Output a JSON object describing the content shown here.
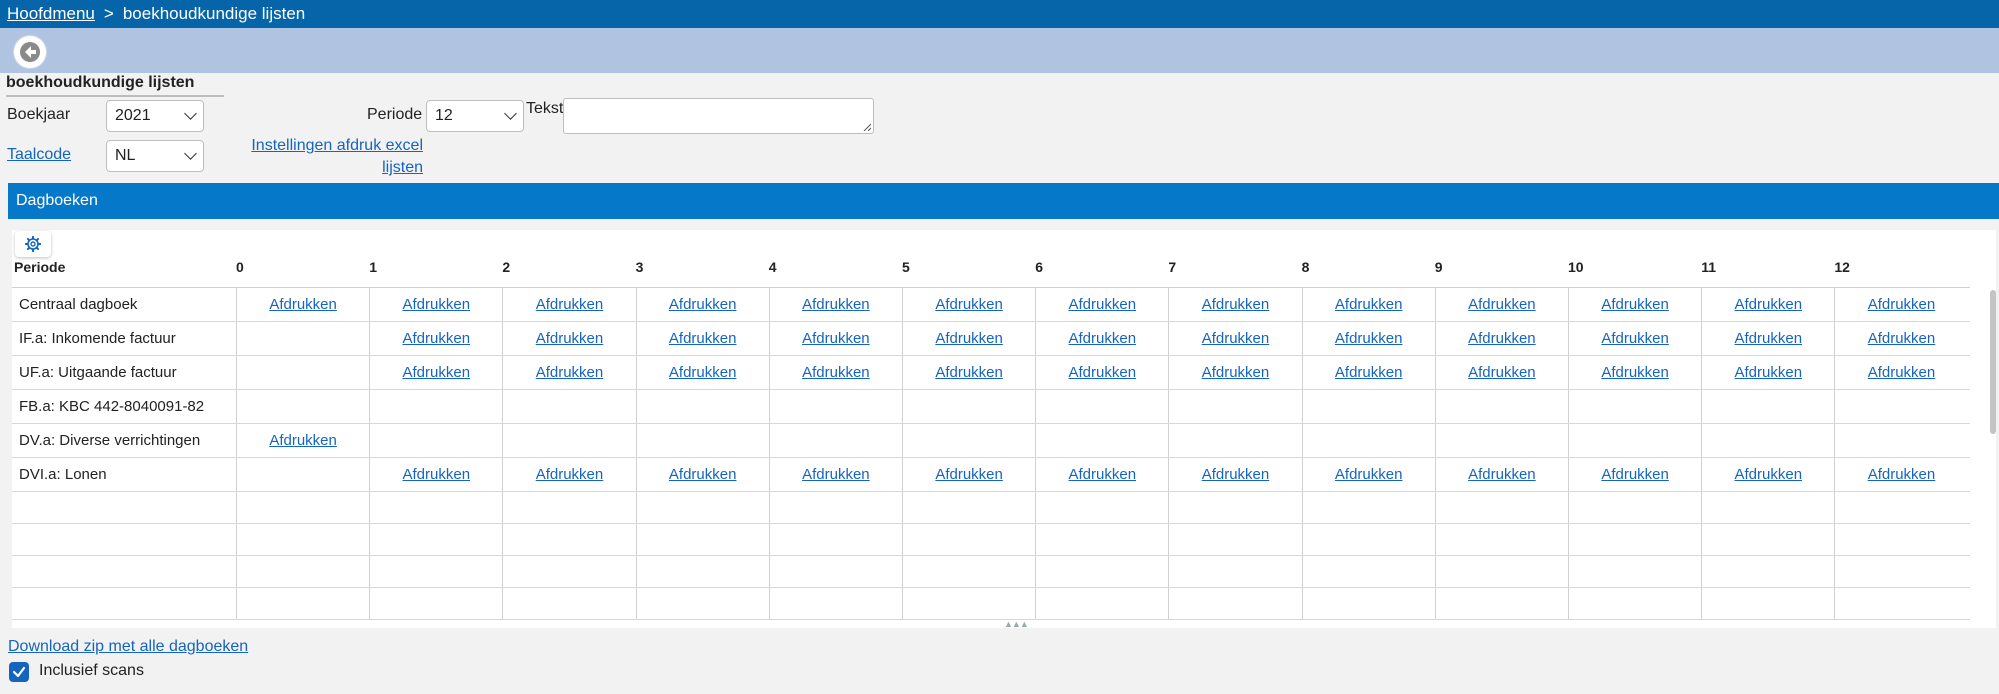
{
  "breadcrumb": {
    "home": "Hoofdmenu",
    "separator": ">",
    "current": "boekhoudkundige lijsten"
  },
  "section_title": "boekhoudkundige lijsten",
  "form": {
    "boekjaar_label": "Boekjaar",
    "boekjaar_value": "2021",
    "taalcode_label": "Taalcode",
    "taalcode_value": "NL",
    "periode_label": "Periode",
    "periode_value": "12",
    "tekst_label": "Tekst",
    "tekst_value": "",
    "settings_link": "Instellingen afdruk excel lijsten"
  },
  "panel": {
    "title": "Dagboeken"
  },
  "grid": {
    "period_header": "Periode",
    "columns": [
      "0",
      "1",
      "2",
      "3",
      "4",
      "5",
      "6",
      "7",
      "8",
      "9",
      "10",
      "11",
      "12"
    ],
    "action_label": "Afdrukken",
    "rows": [
      {
        "name": "Centraal dagboek",
        "cells": [
          1,
          1,
          1,
          1,
          1,
          1,
          1,
          1,
          1,
          1,
          1,
          1,
          1
        ]
      },
      {
        "name": "IF.a: Inkomende factuur",
        "cells": [
          0,
          1,
          1,
          1,
          1,
          1,
          1,
          1,
          1,
          1,
          1,
          1,
          1
        ]
      },
      {
        "name": "UF.a: Uitgaande factuur",
        "cells": [
          0,
          1,
          1,
          1,
          1,
          1,
          1,
          1,
          1,
          1,
          1,
          1,
          1
        ]
      },
      {
        "name": "FB.a: KBC 442-8040091-82",
        "cells": [
          0,
          0,
          0,
          0,
          0,
          0,
          0,
          0,
          0,
          0,
          0,
          0,
          0
        ]
      },
      {
        "name": "DV.a: Diverse verrichtingen",
        "cells": [
          1,
          0,
          0,
          0,
          0,
          0,
          0,
          0,
          0,
          0,
          0,
          0,
          0
        ]
      },
      {
        "name": "DVI.a: Lonen",
        "cells": [
          0,
          1,
          1,
          1,
          1,
          1,
          1,
          1,
          1,
          1,
          1,
          1,
          1
        ]
      }
    ],
    "empty_rows": 4
  },
  "footer": {
    "download_link": "Download zip met alle dagboeken",
    "include_scans_label": "Inclusief scans",
    "include_scans_checked": true
  },
  "icons": {
    "back": "back-arrow-icon",
    "settings": "gear-icon",
    "check": "checkmark-icon"
  },
  "colors": {
    "topbar": "#0565a8",
    "toolbar": "#b0c4e2",
    "panel_header": "#0678c9",
    "link": "#1565c0"
  }
}
